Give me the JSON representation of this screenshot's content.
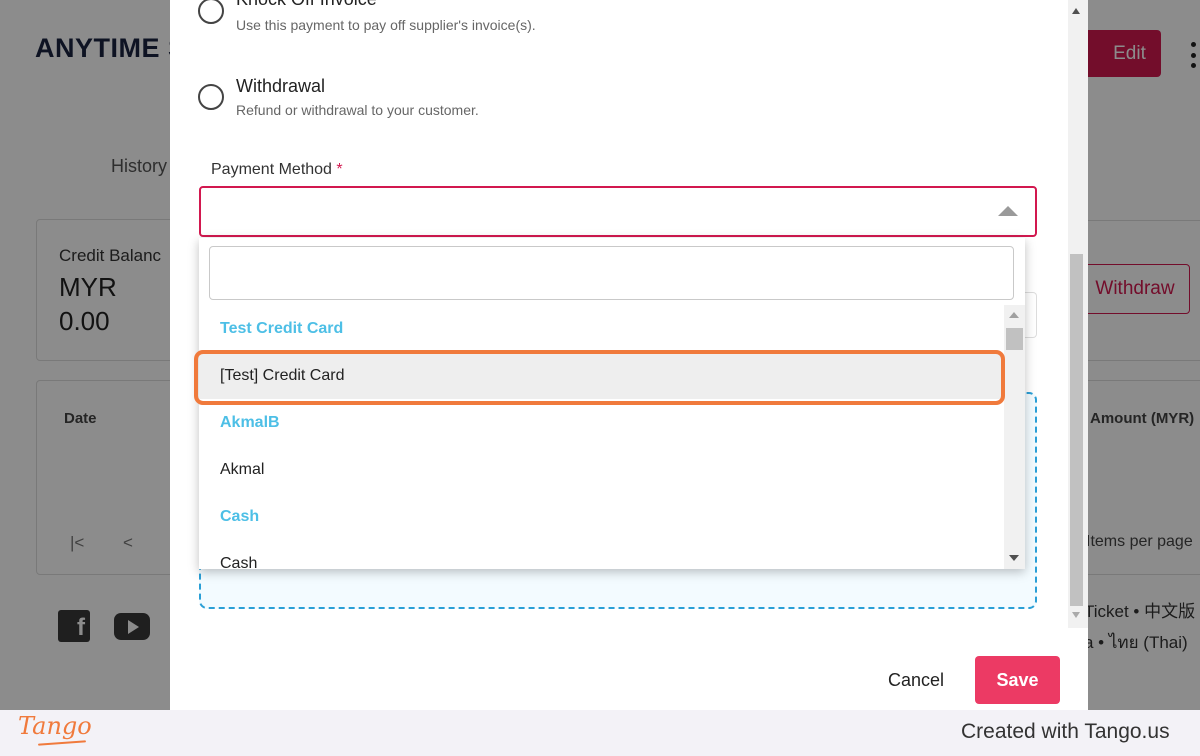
{
  "background": {
    "title": "ANYTIME S",
    "edit_label": "Edit",
    "tab_history": "History",
    "credit_balance_label": "Credit Balanc",
    "currency": "MYR",
    "balance": "0.00",
    "withdraw_label": "Withdraw",
    "table_date_header": "Date",
    "table_amount_header": "Amount (MYR)",
    "pagination_first": "|<",
    "pagination_prev": "<",
    "items_per_page": "Items per page",
    "lang_line_1": "Ticket • 中文版",
    "lang_line_2": "a • ไทย (Thai)",
    "facebook_glyph": "f"
  },
  "modal": {
    "options": [
      {
        "title": "Knock Off Invoice",
        "desc": "Use this payment to pay off supplier's invoice(s)."
      },
      {
        "title": "Withdrawal",
        "desc": "Refund or withdrawal to your customer."
      }
    ],
    "payment_method_label": "Payment Method",
    "required_marker": "*",
    "search_value": "",
    "dropdown_items": [
      {
        "type": "group",
        "label": "Test Credit Card"
      },
      {
        "type": "option",
        "label": "[Test] Credit Card",
        "hovered": true
      },
      {
        "type": "group",
        "label": "AkmalB"
      },
      {
        "type": "option",
        "label": "Akmal"
      },
      {
        "type": "group",
        "label": "Cash"
      },
      {
        "type": "option",
        "label": "Cash"
      }
    ],
    "cancel_label": "Cancel",
    "save_label": "Save"
  },
  "footer": {
    "logo_text": "Tango",
    "created_text": "Created with Tango.us"
  },
  "colors": {
    "accent": "#d2184f",
    "save": "#ec3a64",
    "group_label": "#4dbfe6",
    "highlight": "#f07a3c",
    "dashed": "#2a9fd6"
  },
  "icons": [
    "facebook-icon",
    "youtube-icon",
    "dropdown-caret-icon",
    "kebab-menu-icon",
    "radio-icon"
  ]
}
